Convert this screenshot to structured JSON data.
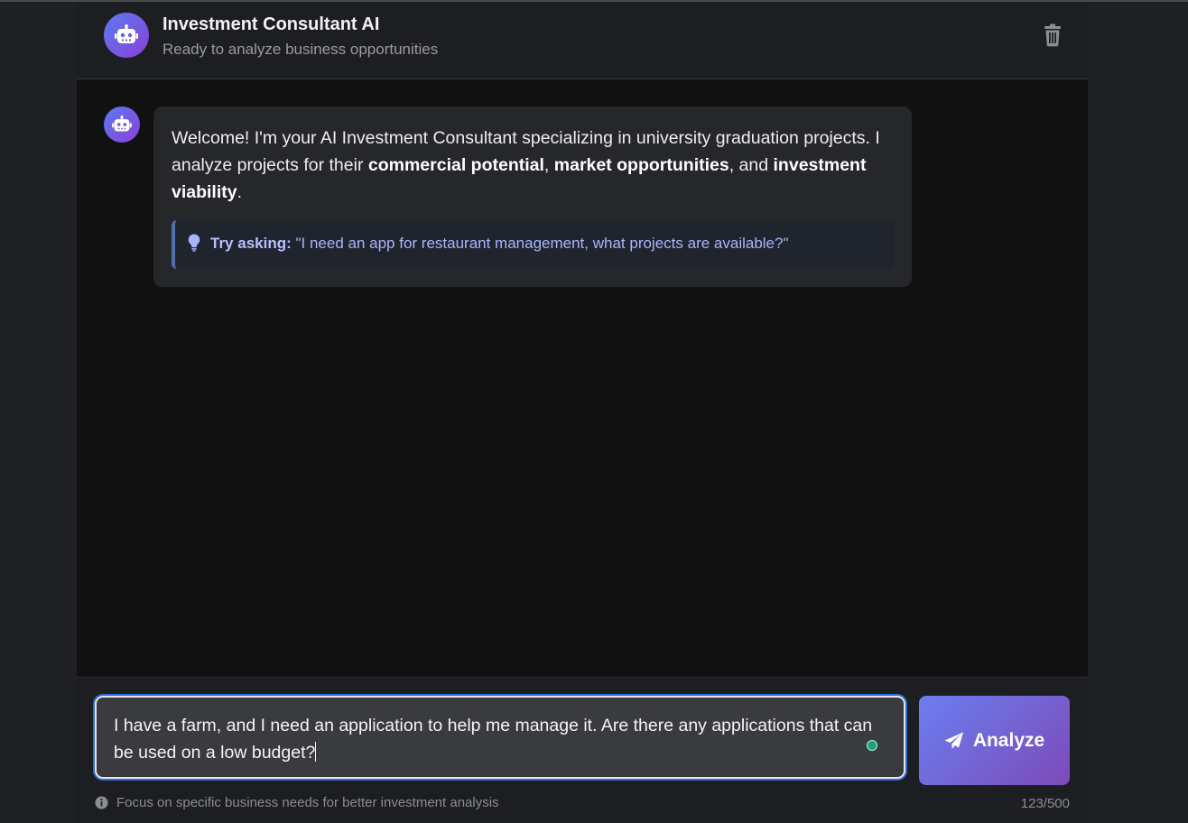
{
  "header": {
    "title": "Investment Consultant AI",
    "subtitle": "Ready to analyze business opportunities"
  },
  "message": {
    "welcome_start": "Welcome! I'm your AI Investment Consultant specializing in university graduation projects. I analyze projects for their ",
    "bold_1": "commercial potential",
    "sep_1": ", ",
    "bold_2": "market opportunities",
    "sep_2": ", and ",
    "bold_3": "investment viability",
    "end": ".",
    "tip_label": "Try asking:",
    "tip_text": " \"I need an app for restaurant management, what projects are available?\""
  },
  "composer": {
    "value": "I have a farm, and I need an application to help me manage it. Are there any applications that can be used on a low budget?",
    "button_label": "Analyze",
    "hint": "Focus on specific business needs for better investment analysis",
    "counter": "123/500"
  },
  "icons": [
    "robot-icon",
    "trash-icon",
    "lightbulb-icon",
    "paper-plane-icon",
    "info-icon"
  ],
  "colors": {
    "accent_gradient_start": "#5a7cf0",
    "accent_gradient_end": "#8a3fd8",
    "tip_text": "#aab4ff",
    "status_dot": "#1aa37a"
  }
}
